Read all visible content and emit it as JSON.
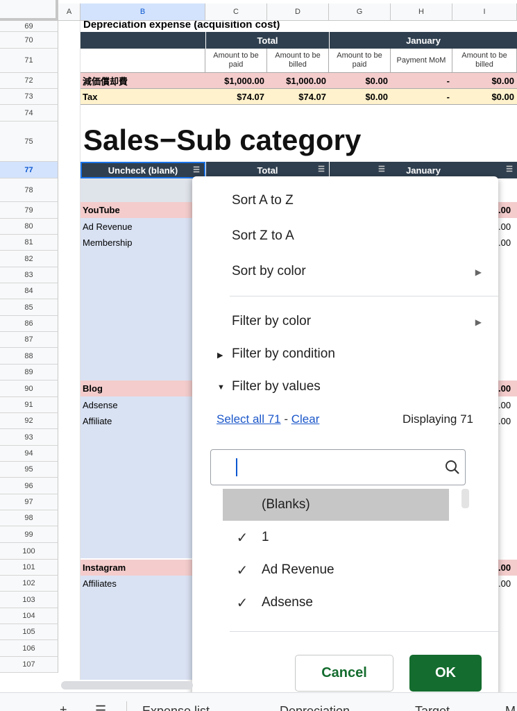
{
  "columns": [
    "A",
    "B",
    "C",
    "D",
    "G",
    "H",
    "I"
  ],
  "rows": [
    "69",
    "70",
    "71",
    "72",
    "73",
    "74",
    "75",
    "77",
    "78",
    "79",
    "80",
    "81",
    "82",
    "83",
    "84",
    "85",
    "86",
    "87",
    "88",
    "89",
    "90",
    "91",
    "92",
    "93",
    "94",
    "95",
    "96",
    "97",
    "98",
    "99",
    "100",
    "101",
    "102",
    "103",
    "104",
    "105",
    "106",
    "107"
  ],
  "section1": {
    "title": "Depreciation expense (acquisition cost)",
    "header_total": "Total",
    "header_january": "January",
    "sub_amount_paid": "Amount to be paid",
    "sub_amount_billed": "Amount to be billed",
    "sub_payment_mom": "Payment MoM",
    "row72": {
      "label": "減価償却費",
      "c": "$1,000.00",
      "d": "$1,000.00",
      "g": "$0.00",
      "h": "-",
      "i": "$0.00"
    },
    "row73": {
      "label": "Tax",
      "c": "$74.07",
      "d": "$74.07",
      "g": "$0.00",
      "h": "-",
      "i": "$0.00"
    }
  },
  "section2": {
    "title": "Sales−Sub category",
    "filter_header_b": "Uncheck (blank)",
    "filter_header_total": "Total",
    "filter_header_january": "January",
    "groups": {
      "youtube": "YouTube",
      "ad_revenue": "Ad Revenue",
      "membership": "Membership",
      "blog": "Blog",
      "adsense": "Adsense",
      "affiliate": "Affiliate",
      "instagram": "Instagram",
      "affiliates": "Affiliates"
    },
    "right_values": {
      "r79": ".00",
      "r80": ".00",
      "r81": ".00",
      "r90": ".00",
      "r91": ".00",
      "r92": ".00",
      "r101": ".00",
      "r102": ".00"
    }
  },
  "filter_menu": {
    "sort_az": "Sort A to Z",
    "sort_za": "Sort Z to A",
    "sort_by_color": "Sort by color",
    "filter_by_color": "Filter by color",
    "filter_by_condition": "Filter by condition",
    "filter_by_values": "Filter by values",
    "select_all": "Select all 71",
    "separator": " - ",
    "clear": "Clear",
    "displaying": "Displaying 71",
    "search_value": "",
    "values": [
      {
        "label": "(Blanks)",
        "checked": false
      },
      {
        "label": "1",
        "checked": true
      },
      {
        "label": "Ad Revenue",
        "checked": true
      },
      {
        "label": "Adsense",
        "checked": true
      }
    ],
    "cancel_label": "Cancel",
    "ok_label": "OK"
  },
  "sheet_tabs": [
    "Expense list",
    "Depreciation",
    "Target",
    "M"
  ],
  "colors": {
    "ok_green": "#146c2e",
    "header_dark": "#2f3f4f",
    "pink": "#f4cccc",
    "yellow": "#fff2cc",
    "blue": "#d9e2f3"
  },
  "icons": [
    "search-icon",
    "checkmark-icon",
    "filter-icon",
    "submenu-arrow-icon",
    "collapse-triangle-icon",
    "expand-triangle-icon",
    "sheets-menu-icon",
    "add-sheet-icon"
  ]
}
